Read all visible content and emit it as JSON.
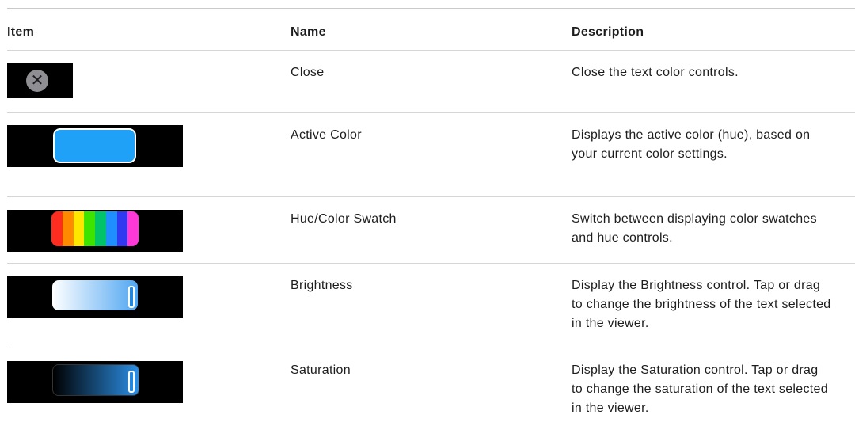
{
  "headers": {
    "item": "Item",
    "name": "Name",
    "description": "Description"
  },
  "rows": [
    {
      "name": "Close",
      "description": "Close the text color controls.",
      "icon": "close-icon"
    },
    {
      "name": "Active Color",
      "description": "Displays the active color (hue), based on your current color settings.",
      "icon": "active-color-swatch",
      "color": "#1ea1f6"
    },
    {
      "name": "Hue/Color Swatch",
      "description": "Switch between displaying color swatches and hue controls.",
      "icon": "hue-swatch-icon",
      "hues": [
        "#ff2d1f",
        "#ff8a00",
        "#ffe600",
        "#3ee400",
        "#00c36a",
        "#1f8fff",
        "#3038f0",
        "#ff38d8"
      ]
    },
    {
      "name": "Brightness",
      "description": "Display the Brightness control. Tap or drag to change the brightness of the text selected in the viewer.",
      "icon": "brightness-slider-icon"
    },
    {
      "name": "Saturation",
      "description": "Display the Saturation control. Tap or drag to change the saturation of the text selected in the viewer.",
      "icon": "saturation-slider-icon"
    }
  ]
}
